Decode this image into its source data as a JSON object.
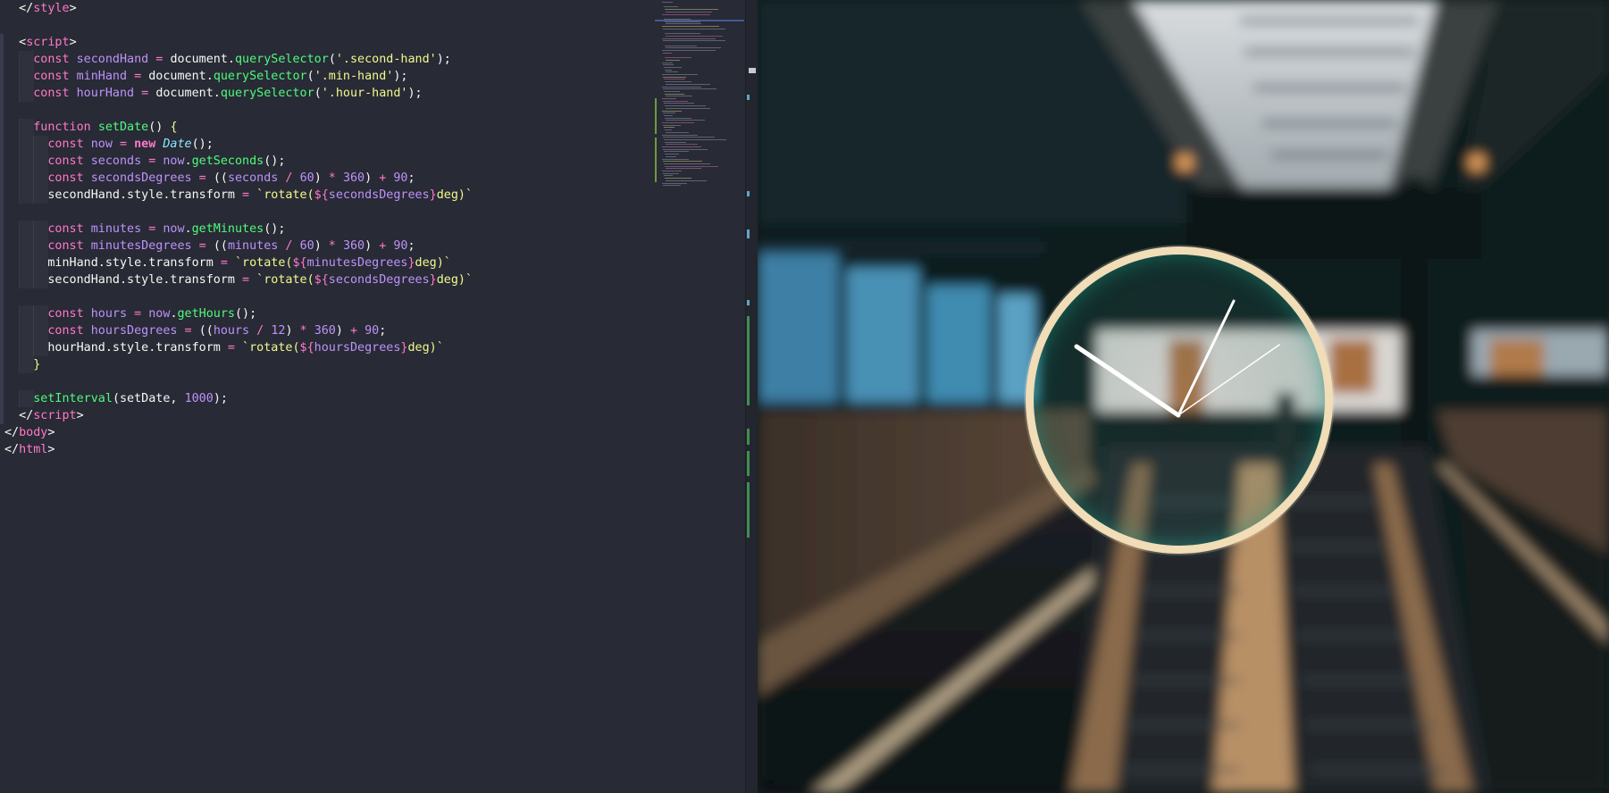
{
  "editor": {
    "lines": [
      [
        [
          "t-punc",
          "  </"
        ],
        [
          "t-tag",
          "style"
        ],
        [
          "t-punc",
          ">"
        ]
      ],
      [],
      [
        [
          "t-punc",
          "  <"
        ],
        [
          "t-tag",
          "script"
        ],
        [
          "t-punc",
          ">"
        ]
      ],
      [
        [
          "t-kw",
          "    const "
        ],
        [
          "t-var",
          "secondHand"
        ],
        [
          "t-op",
          " = "
        ],
        [
          "t-plain",
          "document."
        ],
        [
          "t-fn",
          "querySelector"
        ],
        [
          "t-punc",
          "("
        ],
        [
          "t-str",
          "'.second-hand'"
        ],
        [
          "t-punc",
          ");"
        ]
      ],
      [
        [
          "t-kw",
          "    const "
        ],
        [
          "t-var",
          "minHand"
        ],
        [
          "t-op",
          " = "
        ],
        [
          "t-plain",
          "document."
        ],
        [
          "t-fn",
          "querySelector"
        ],
        [
          "t-punc",
          "("
        ],
        [
          "t-str",
          "'.min-hand'"
        ],
        [
          "t-punc",
          ");"
        ]
      ],
      [
        [
          "t-kw",
          "    const "
        ],
        [
          "t-var",
          "hourHand"
        ],
        [
          "t-op",
          " = "
        ],
        [
          "t-plain",
          "document."
        ],
        [
          "t-fn",
          "querySelector"
        ],
        [
          "t-punc",
          "("
        ],
        [
          "t-str",
          "'.hour-hand'"
        ],
        [
          "t-punc",
          ");"
        ]
      ],
      [],
      [
        [
          "t-kw",
          "    function "
        ],
        [
          "t-fn",
          "setDate"
        ],
        [
          "t-punc",
          "() "
        ],
        [
          "t-brace",
          "{"
        ]
      ],
      [
        [
          "t-kw",
          "      const "
        ],
        [
          "t-var",
          "now"
        ],
        [
          "t-op",
          " = "
        ],
        [
          "t-new",
          "new "
        ],
        [
          "t-cls",
          "Date"
        ],
        [
          "t-punc",
          "();"
        ]
      ],
      [
        [
          "t-kw",
          "      const "
        ],
        [
          "t-var",
          "seconds"
        ],
        [
          "t-op",
          " = "
        ],
        [
          "t-var",
          "now"
        ],
        [
          "t-plain",
          "."
        ],
        [
          "t-fn",
          "getSeconds"
        ],
        [
          "t-punc",
          "();"
        ]
      ],
      [
        [
          "t-kw",
          "      const "
        ],
        [
          "t-var",
          "secondsDegrees"
        ],
        [
          "t-op",
          " = "
        ],
        [
          "t-punc",
          "(("
        ],
        [
          "t-var",
          "seconds"
        ],
        [
          "t-op",
          " / "
        ],
        [
          "t-num",
          "60"
        ],
        [
          "t-punc",
          ")"
        ],
        [
          "t-op",
          " * "
        ],
        [
          "t-num",
          "360"
        ],
        [
          "t-punc",
          ")"
        ],
        [
          "t-op",
          " + "
        ],
        [
          "t-num",
          "90"
        ],
        [
          "t-punc",
          ";"
        ]
      ],
      [
        [
          "t-plain",
          "      secondHand.style.transform"
        ],
        [
          "t-op",
          " = "
        ],
        [
          "t-str",
          "`rotate("
        ],
        [
          "t-kw",
          "${"
        ],
        [
          "t-var",
          "secondsDegrees"
        ],
        [
          "t-kw",
          "}"
        ],
        [
          "t-str",
          "deg)`"
        ]
      ],
      [],
      [
        [
          "t-kw",
          "      const "
        ],
        [
          "t-var",
          "minutes"
        ],
        [
          "t-op",
          " = "
        ],
        [
          "t-var",
          "now"
        ],
        [
          "t-plain",
          "."
        ],
        [
          "t-fn",
          "getMinutes"
        ],
        [
          "t-punc",
          "();"
        ]
      ],
      [
        [
          "t-kw",
          "      const "
        ],
        [
          "t-var",
          "minutesDegrees"
        ],
        [
          "t-op",
          " = "
        ],
        [
          "t-punc",
          "(("
        ],
        [
          "t-var",
          "minutes"
        ],
        [
          "t-op",
          " / "
        ],
        [
          "t-num",
          "60"
        ],
        [
          "t-punc",
          ")"
        ],
        [
          "t-op",
          " * "
        ],
        [
          "t-num",
          "360"
        ],
        [
          "t-punc",
          ")"
        ],
        [
          "t-op",
          " + "
        ],
        [
          "t-num",
          "90"
        ],
        [
          "t-punc",
          ";"
        ]
      ],
      [
        [
          "t-plain",
          "      minHand.style.transform"
        ],
        [
          "t-op",
          " = "
        ],
        [
          "t-str",
          "`rotate("
        ],
        [
          "t-kw",
          "${"
        ],
        [
          "t-var",
          "minutesDegrees"
        ],
        [
          "t-kw",
          "}"
        ],
        [
          "t-str",
          "deg)`"
        ]
      ],
      [
        [
          "t-plain",
          "      secondHand.style.transform"
        ],
        [
          "t-op",
          " = "
        ],
        [
          "t-str",
          "`rotate("
        ],
        [
          "t-kw",
          "${"
        ],
        [
          "t-var",
          "secondsDegrees"
        ],
        [
          "t-kw",
          "}"
        ],
        [
          "t-str",
          "deg)`"
        ]
      ],
      [],
      [
        [
          "t-kw",
          "      const "
        ],
        [
          "t-var",
          "hours"
        ],
        [
          "t-op",
          " = "
        ],
        [
          "t-var",
          "now"
        ],
        [
          "t-plain",
          "."
        ],
        [
          "t-fn",
          "getHours"
        ],
        [
          "t-punc",
          "();"
        ]
      ],
      [
        [
          "t-kw",
          "      const "
        ],
        [
          "t-var",
          "hoursDegrees"
        ],
        [
          "t-op",
          " = "
        ],
        [
          "t-punc",
          "(("
        ],
        [
          "t-var",
          "hours"
        ],
        [
          "t-op",
          " / "
        ],
        [
          "t-num",
          "12"
        ],
        [
          "t-punc",
          ")"
        ],
        [
          "t-op",
          " * "
        ],
        [
          "t-num",
          "360"
        ],
        [
          "t-punc",
          ")"
        ],
        [
          "t-op",
          " + "
        ],
        [
          "t-num",
          "90"
        ],
        [
          "t-punc",
          ";"
        ]
      ],
      [
        [
          "t-plain",
          "      hourHand.style.transform"
        ],
        [
          "t-op",
          " = "
        ],
        [
          "t-str",
          "`rotate("
        ],
        [
          "t-kw",
          "${"
        ],
        [
          "t-var",
          "hoursDegrees"
        ],
        [
          "t-kw",
          "}"
        ],
        [
          "t-str",
          "deg)`"
        ]
      ],
      [
        [
          "t-brace",
          "    }"
        ]
      ],
      [],
      [
        [
          "t-fn",
          "    setInterval"
        ],
        [
          "t-punc",
          "("
        ],
        [
          "t-plain",
          "setDate, "
        ],
        [
          "t-num",
          "1000"
        ],
        [
          "t-punc",
          ");"
        ]
      ],
      [
        [
          "t-punc",
          "  </"
        ],
        [
          "t-tag",
          "script"
        ],
        [
          "t-punc",
          ">"
        ]
      ],
      [
        [
          "t-punc",
          "</"
        ],
        [
          "t-tag",
          "body"
        ],
        [
          "t-punc",
          ">"
        ]
      ],
      [
        [
          "t-punc",
          "</"
        ],
        [
          "t-tag",
          "html"
        ],
        [
          "t-punc",
          ">"
        ]
      ]
    ]
  },
  "preview": {
    "clock": {
      "frame_color": "#f1ddb7",
      "glow_color": "#2aa08a"
    }
  }
}
